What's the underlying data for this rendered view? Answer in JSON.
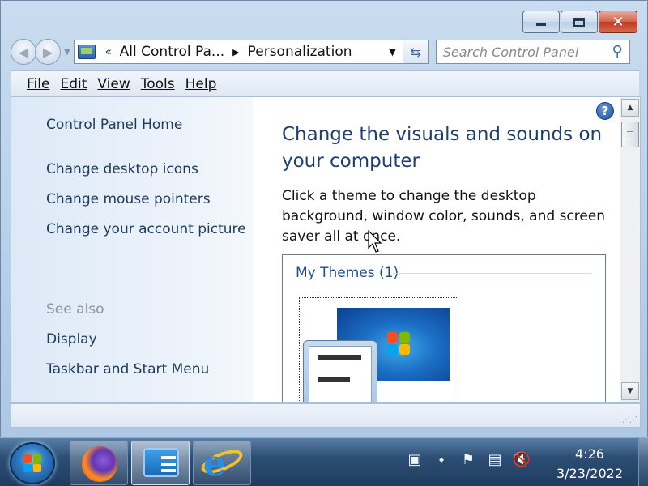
{
  "window": {
    "caption_buttons": {
      "minimize_icon": "minimize-icon",
      "maximize_icon": "maximize-icon",
      "close_glyph": "✕"
    }
  },
  "address_bar": {
    "prefix": "«",
    "crumbs": [
      "All Control Pa...",
      "Personalization"
    ],
    "search_placeholder": "Search Control Panel"
  },
  "menu": {
    "items": [
      "File",
      "Edit",
      "View",
      "Tools",
      "Help"
    ]
  },
  "sidebar": {
    "home": "Control Panel Home",
    "links": [
      "Change desktop icons",
      "Change mouse pointers",
      "Change your account picture"
    ],
    "see_also_label": "See also",
    "see_also_links": [
      "Display",
      "Taskbar and Start Menu"
    ]
  },
  "main": {
    "heading": "Change the visuals and sounds on your computer",
    "description": "Click a theme to change the desktop background, window color, sounds, and screen saver all at once.",
    "themes_group": "My Themes (1)",
    "help_glyph": "?"
  },
  "taskbar": {
    "pinned": [
      "firefox-icon",
      "control-panel-icon",
      "internet-explorer-icon"
    ],
    "tray_icons": [
      "action-center-flag-icon",
      "network-icon",
      "volume-muted-icon"
    ],
    "time": "4:26",
    "date": "3/23/2022"
  },
  "colors": {
    "heading": "#1e3f6a",
    "link": "#1e395b",
    "taskbar": "#1f3c5e"
  }
}
